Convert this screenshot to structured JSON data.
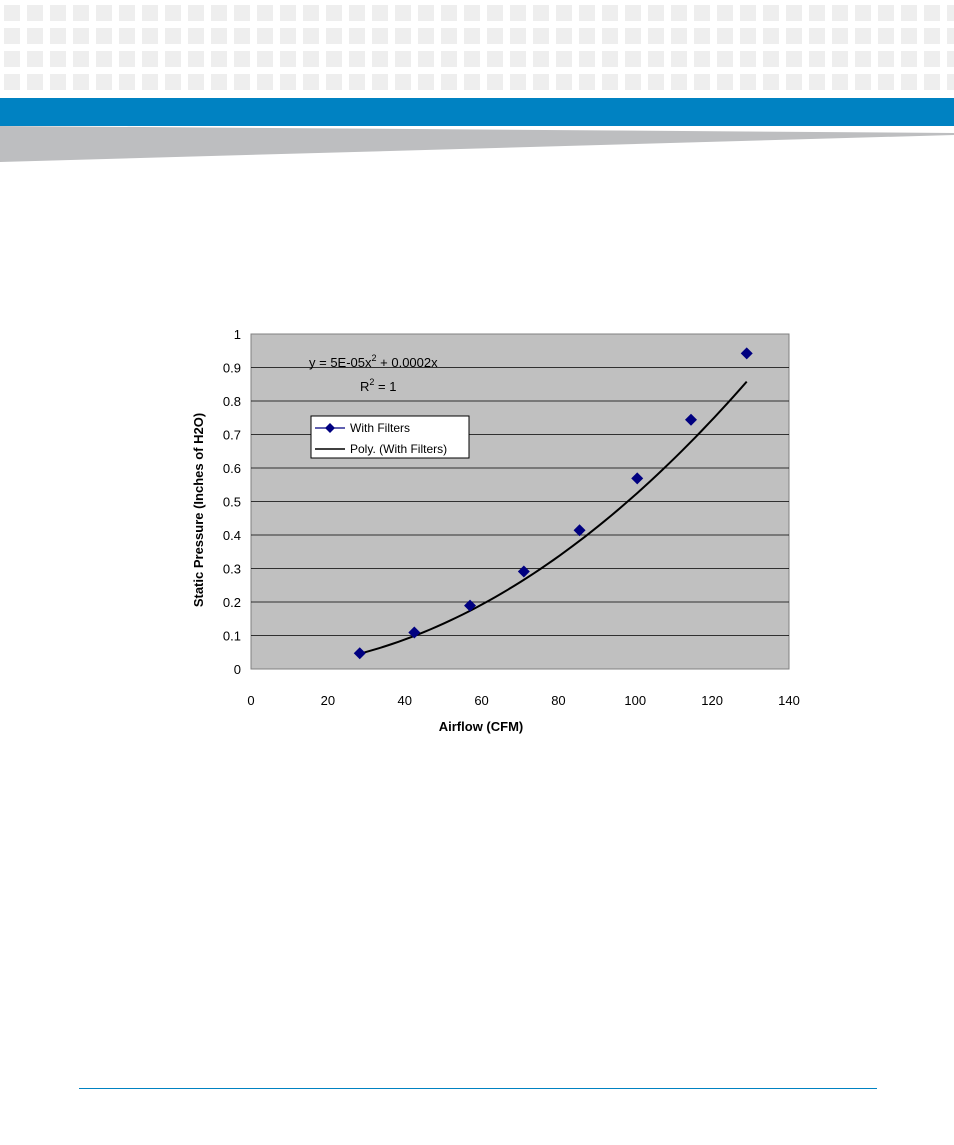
{
  "page": {
    "header_blue_color": "#0082C2",
    "header_grey_color": "#BDBEC0",
    "pattern_color": "#EEEEEE",
    "footer_rule_color": "#0082C2"
  },
  "chart_data": {
    "type": "scatter",
    "title": "",
    "xlabel": "Airflow (CFM)",
    "ylabel": "Static Pressure (Inches of  H2O)",
    "xlim": [
      0,
      140
    ],
    "ylim": [
      0,
      1
    ],
    "x_ticks": [
      0,
      20,
      40,
      60,
      80,
      100,
      120,
      140
    ],
    "y_ticks": [
      0,
      0.1,
      0.2,
      0.3,
      0.4,
      0.5,
      0.6,
      0.7,
      0.8,
      0.9,
      1
    ],
    "grid": "horizontal",
    "plot_background": "#C0C0C0",
    "series": [
      {
        "name": "With Filters",
        "color": "#000080",
        "marker": "diamond",
        "x": [
          28.3,
          42.5,
          57.0,
          71.0,
          85.5,
          100.5,
          114.5,
          129.0
        ],
        "y": [
          0.047,
          0.109,
          0.189,
          0.291,
          0.414,
          0.569,
          0.744,
          0.942
        ]
      }
    ],
    "trendline": {
      "name": "Poly. (With Filters)",
      "color": "#000000",
      "coefficients": {
        "a": 5e-05,
        "b": 0.0002,
        "c": 0
      },
      "equation": "y = 5E-05x",
      "equation_exp": "2",
      "equation_rest": " + 0.0002x",
      "r2_prefix": "R",
      "r2_exp": "2",
      "r2_suffix": " = 1"
    },
    "legend": {
      "position": "upper-left-inside"
    }
  }
}
